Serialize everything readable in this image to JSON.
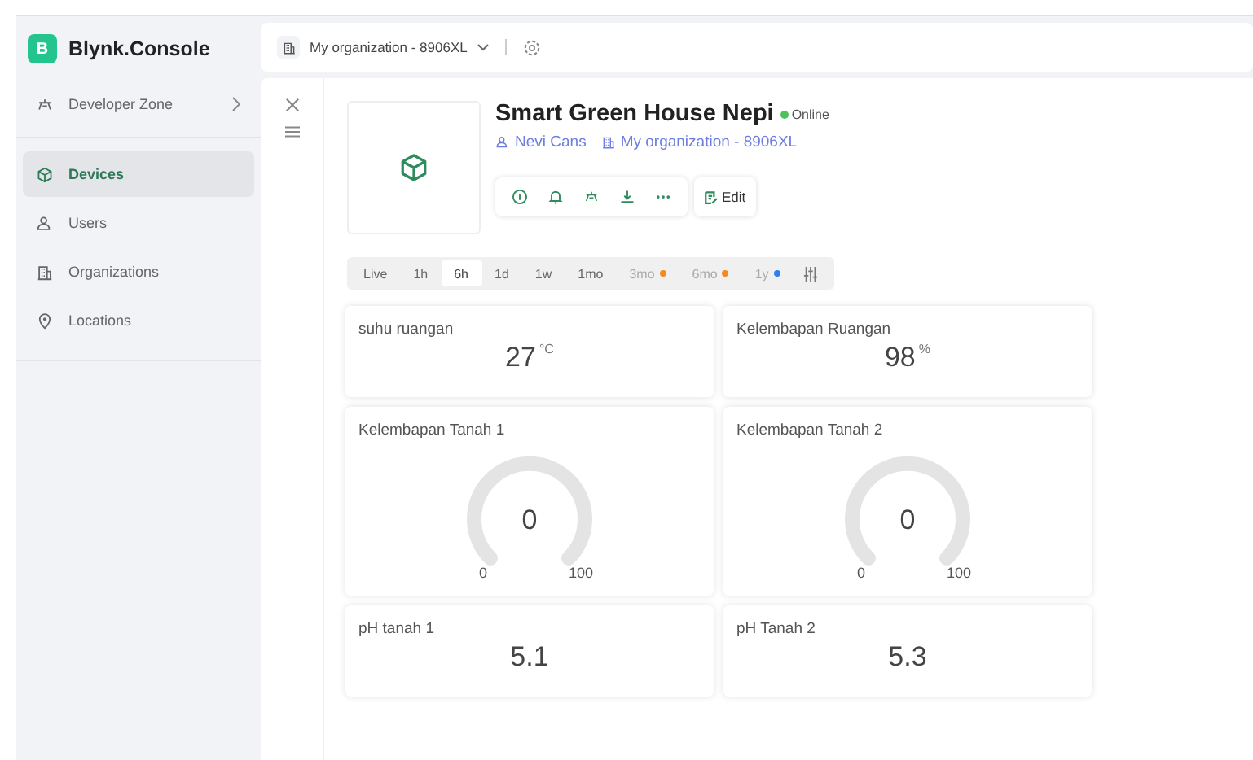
{
  "brand": {
    "letter": "B",
    "name": "Blynk.Console"
  },
  "sidebar": {
    "items": [
      {
        "label": "Developer Zone",
        "selected": false,
        "expandable": true
      },
      {
        "label": "Devices",
        "selected": true,
        "expandable": false
      },
      {
        "label": "Users",
        "selected": false,
        "expandable": false
      },
      {
        "label": "Organizations",
        "selected": false,
        "expandable": false
      },
      {
        "label": "Locations",
        "selected": false,
        "expandable": false
      }
    ]
  },
  "top_bar": {
    "organization": "My organization - 8906XL"
  },
  "device": {
    "title": "Smart Green House Nepi",
    "status": {
      "label": "Online",
      "online": true
    },
    "owner": "Nevi Cans",
    "organization": "My organization - 8906XL",
    "edit_label": "Edit"
  },
  "time_range": [
    {
      "label": "Live",
      "selected": false
    },
    {
      "label": "1h",
      "selected": false
    },
    {
      "label": "6h",
      "selected": true
    },
    {
      "label": "1d",
      "selected": false
    },
    {
      "label": "1w",
      "selected": false
    },
    {
      "label": "1mo",
      "selected": false
    },
    {
      "label": "3mo",
      "selected": false,
      "color": "#f5891f"
    },
    {
      "label": "6mo",
      "selected": false,
      "color": "#f5891f"
    },
    {
      "label": "1y",
      "selected": false,
      "color": "#2f80ed"
    }
  ],
  "widgets": [
    {
      "kind": "value",
      "title": "suhu ruangan",
      "value": "27",
      "unit": "°C"
    },
    {
      "kind": "value",
      "title": "Kelembapan Ruangan",
      "value": "98",
      "unit": "%"
    },
    {
      "kind": "gauge",
      "title": "Kelembapan Tanah 1",
      "value": "0",
      "min": "0",
      "max": "100"
    },
    {
      "kind": "gauge",
      "title": "Kelembapan Tanah 2",
      "value": "0",
      "min": "0",
      "max": "100"
    },
    {
      "kind": "value",
      "title": "pH tanah 1",
      "value": "5.1"
    },
    {
      "kind": "value",
      "title": "pH Tanah 2",
      "value": "5.3"
    }
  ]
}
